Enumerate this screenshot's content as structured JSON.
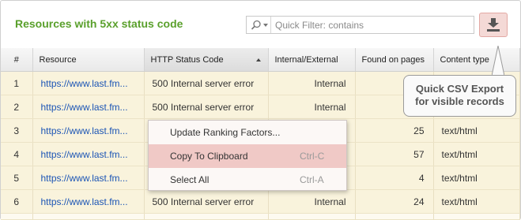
{
  "panel": {
    "title": "Resources with 5xx status code"
  },
  "filter": {
    "placeholder": "Quick Filter: contains",
    "value": ""
  },
  "export": {
    "icon": "download-icon",
    "accent": "#f4d9d6"
  },
  "table": {
    "columns": [
      "#",
      "Resource",
      "HTTP Status Code",
      "Internal/External",
      "Found on pages",
      "Content type"
    ],
    "sorted_column": "HTTP Status Code",
    "sort_direction": "ascending",
    "rows": [
      {
        "num": "1",
        "resource": "https://www.last.fm...",
        "status": "500 Internal server error",
        "scope": "Internal",
        "found": "",
        "type": ""
      },
      {
        "num": "2",
        "resource": "https://www.last.fm...",
        "status": "500 Internal server error",
        "scope": "Internal",
        "found": "",
        "type": ""
      },
      {
        "num": "3",
        "resource": "https://www.last.fm...",
        "status": "",
        "scope": "",
        "found": "25",
        "type": "text/html"
      },
      {
        "num": "4",
        "resource": "https://www.last.fm...",
        "status": "",
        "scope": "",
        "found": "57",
        "type": "text/html"
      },
      {
        "num": "5",
        "resource": "https://www.last.fm...",
        "status": "",
        "scope": "",
        "found": "4",
        "type": "text/html"
      },
      {
        "num": "6",
        "resource": "https://www.last.fm...",
        "status": "500 Internal server error",
        "scope": "Internal",
        "found": "24",
        "type": "text/html"
      }
    ],
    "row_color": "#f9f3dc"
  },
  "context_menu": {
    "items": [
      {
        "label": "Update Ranking Factors...",
        "shortcut": ""
      },
      {
        "label": "Copy To Clipboard",
        "shortcut": "Ctrl-C",
        "highlighted": true
      },
      {
        "label": "Select All",
        "shortcut": "Ctrl-A"
      }
    ]
  },
  "callout": {
    "line1": "Quick CSV Export",
    "line2": "for visible records"
  },
  "colors": {
    "title": "#5aa02c",
    "link": "#1c55b5",
    "highlight": "#f0c9c6"
  }
}
